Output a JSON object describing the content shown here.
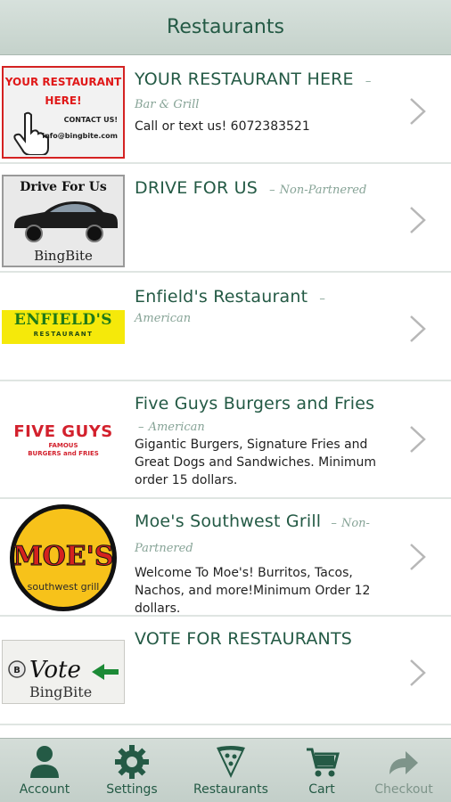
{
  "header": {
    "title": "Restaurants"
  },
  "restaurants": [
    {
      "name": "YOUR RESTAURANT HERE",
      "category_prefix": "–",
      "category": "Bar & Grill",
      "description": "Call or text us! 6072383521",
      "thumb": {
        "heading_line1": "YOUR RESTAURANT",
        "heading_line2": "HERE!",
        "contact": "CONTACT US!",
        "email": "info@bingbite.com"
      }
    },
    {
      "name": "DRIVE FOR US",
      "category_prefix": "–",
      "category": "Non-Partnered",
      "description": "",
      "thumb": {
        "heading": "Drive For Us",
        "brand": "BingBite"
      }
    },
    {
      "name": "Enfield's Restaurant",
      "category_prefix": "–",
      "category": "American",
      "description": "",
      "thumb": {
        "wordmark": "ENFIELD'S",
        "sub": "RESTAURANT"
      }
    },
    {
      "name": "Five Guys Burgers and Fries",
      "category_prefix": "–",
      "category": "American",
      "description": "Gigantic Burgers, Signature Fries and Great Dogs and Sandwiches. Minimum order 15 dollars.",
      "thumb": {
        "wordmark": "FIVE GUYS",
        "sub1": "FAMOUS",
        "sub2": "BURGERS and FRIES"
      }
    },
    {
      "name": "Moe's Southwest Grill",
      "category_prefix": "–",
      "category": "Non-Partnered",
      "description": "Welcome To Moe's! Burritos, Tacos, Nachos, and more!Minimum Order 12 dollars.",
      "thumb": {
        "wordmark": "MOE'S",
        "sub": "southwest grill"
      }
    },
    {
      "name": "VOTE FOR RESTAURANTS",
      "category_prefix": "",
      "category": "",
      "description": "",
      "thumb": {
        "word": "Vote",
        "brand": "BingBite"
      }
    }
  ],
  "tabbar": {
    "tabs": [
      {
        "label": "Account",
        "icon": "person-icon"
      },
      {
        "label": "Settings",
        "icon": "gear-icon"
      },
      {
        "label": "Restaurants",
        "icon": "pizza-slice-icon"
      },
      {
        "label": "Cart",
        "icon": "cart-icon"
      },
      {
        "label": "Checkout",
        "icon": "forward-arrow-icon",
        "disabled": true
      }
    ]
  },
  "colors": {
    "accent": "#245a45",
    "header_bg": "#c9d6cf",
    "category": "#86a396",
    "divider": "#dfe5e2"
  }
}
